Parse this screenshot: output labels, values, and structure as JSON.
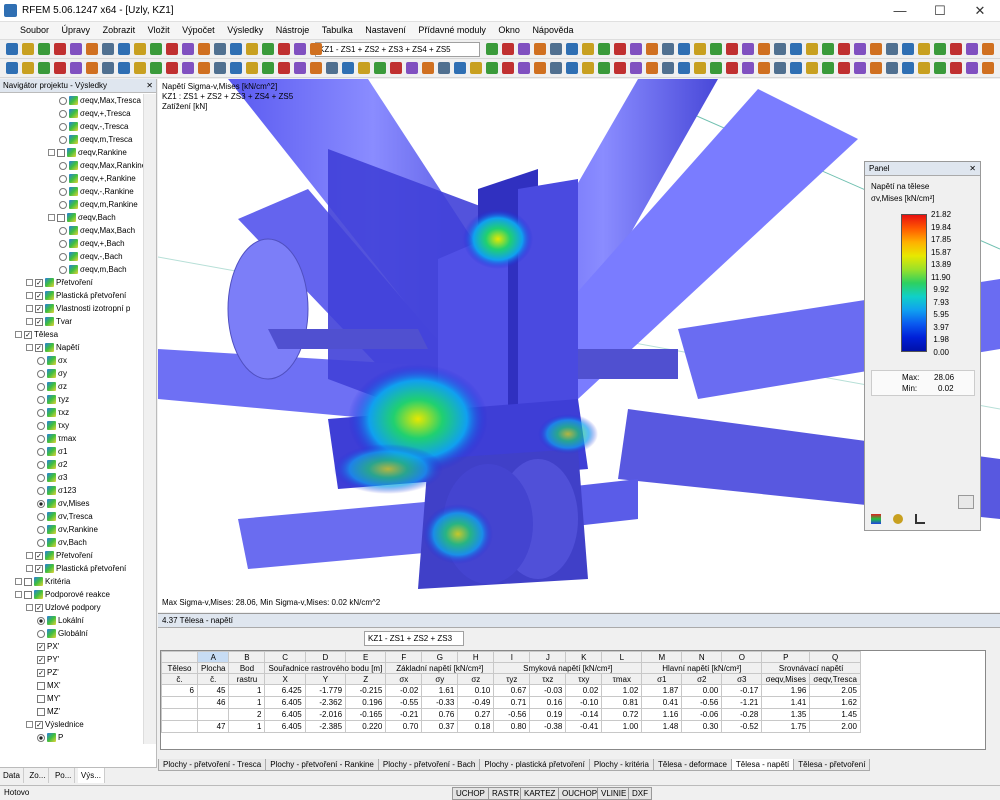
{
  "window": {
    "title": "RFEM 5.06.1247 x64 - [Uzly, KZ1]",
    "min": "—",
    "max": "☐",
    "close": "✕"
  },
  "menu": [
    "Soubor",
    "Úpravy",
    "Zobrazit",
    "Vložit",
    "Výpočet",
    "Výsledky",
    "Nástroje",
    "Tabulka",
    "Nastavení",
    "Přídavné moduly",
    "Okno",
    "Nápověda"
  ],
  "toolbar": {
    "loadcombo": "KZ1 - ZS1 + ZS2 + ZS3 + ZS4 + ZS5"
  },
  "navigator": {
    "title": "Navigátor projektu - Výsledky",
    "close": "✕",
    "rows": [
      {
        "t": "σeqv,Max,Tresca",
        "l": 5,
        "k": "rad"
      },
      {
        "t": "σeqv,+,Tresca",
        "l": 5,
        "k": "rad"
      },
      {
        "t": "σeqv,-,Tresca",
        "l": 5,
        "k": "rad"
      },
      {
        "t": "σeqv,m,Tresca",
        "l": 5,
        "k": "rad"
      },
      {
        "t": "σeqv,Rankine",
        "l": 4,
        "k": "grp"
      },
      {
        "t": "σeqv,Max,Rankine",
        "l": 5,
        "k": "rad"
      },
      {
        "t": "σeqv,+,Rankine",
        "l": 5,
        "k": "rad"
      },
      {
        "t": "σeqv,-,Rankine",
        "l": 5,
        "k": "rad"
      },
      {
        "t": "σeqv,m,Rankine",
        "l": 5,
        "k": "rad"
      },
      {
        "t": "σeqv,Bach",
        "l": 4,
        "k": "grp"
      },
      {
        "t": "σeqv,Max,Bach",
        "l": 5,
        "k": "rad"
      },
      {
        "t": "σeqv,+,Bach",
        "l": 5,
        "k": "rad"
      },
      {
        "t": "σeqv,-,Bach",
        "l": 5,
        "k": "rad"
      },
      {
        "t": "σeqv,m,Bach",
        "l": 5,
        "k": "rad"
      },
      {
        "t": "Přetvoření",
        "l": 2,
        "k": "grpc"
      },
      {
        "t": "Plastická přetvoření",
        "l": 2,
        "k": "grpc"
      },
      {
        "t": "Vlastnosti izotropní p",
        "l": 2,
        "k": "grpc"
      },
      {
        "t": "Tvar",
        "l": 2,
        "k": "grpc"
      },
      {
        "t": "Tělesa",
        "l": 1,
        "k": "chk"
      },
      {
        "t": "Napětí",
        "l": 2,
        "k": "grpc"
      },
      {
        "t": "σx",
        "l": 3,
        "k": "rad"
      },
      {
        "t": "σy",
        "l": 3,
        "k": "rad"
      },
      {
        "t": "σz",
        "l": 3,
        "k": "rad"
      },
      {
        "t": "τyz",
        "l": 3,
        "k": "rad"
      },
      {
        "t": "τxz",
        "l": 3,
        "k": "rad"
      },
      {
        "t": "τxy",
        "l": 3,
        "k": "rad"
      },
      {
        "t": "τmax",
        "l": 3,
        "k": "rad"
      },
      {
        "t": "σ1",
        "l": 3,
        "k": "rad"
      },
      {
        "t": "σ2",
        "l": 3,
        "k": "rad"
      },
      {
        "t": "σ3",
        "l": 3,
        "k": "rad"
      },
      {
        "t": "σ123",
        "l": 3,
        "k": "rad"
      },
      {
        "t": "σv,Mises",
        "l": 3,
        "k": "radon"
      },
      {
        "t": "σv,Tresca",
        "l": 3,
        "k": "rad"
      },
      {
        "t": "σv,Rankine",
        "l": 3,
        "k": "rad"
      },
      {
        "t": "σv,Bach",
        "l": 3,
        "k": "rad"
      },
      {
        "t": "Přetvoření",
        "l": 2,
        "k": "grpc"
      },
      {
        "t": "Plastická přetvoření",
        "l": 2,
        "k": "grpc"
      },
      {
        "t": "Kritéria",
        "l": 1,
        "k": "grp"
      },
      {
        "t": "Podporové reakce",
        "l": 1,
        "k": "grp"
      },
      {
        "t": "Uzlové podpory",
        "l": 2,
        "k": "chk"
      },
      {
        "t": "Lokální",
        "l": 3,
        "k": "radon"
      },
      {
        "t": "Globální",
        "l": 3,
        "k": "rad"
      },
      {
        "t": "PX'",
        "l": 3,
        "k": "chkon"
      },
      {
        "t": "PY'",
        "l": 3,
        "k": "chkon"
      },
      {
        "t": "PZ'",
        "l": 3,
        "k": "chkon"
      },
      {
        "t": "MX'",
        "l": 3,
        "k": "chk0"
      },
      {
        "t": "MY'",
        "l": 3,
        "k": "chk0"
      },
      {
        "t": "MZ'",
        "l": 3,
        "k": "chk0"
      },
      {
        "t": "Výslednice",
        "l": 2,
        "k": "chk"
      },
      {
        "t": "P",
        "l": 3,
        "k": "radon"
      }
    ],
    "tabs": [
      "Data",
      "Zo...",
      "Po...",
      "Výs..."
    ]
  },
  "view": {
    "line1": "Napětí Sigma-v,Mises [kN/cm^2]",
    "line2": "KZ1 : ZS1 + ZS2 + ZS3 + ZS4 + ZS5",
    "line3": "Zatížení [kN]",
    "footer": "Max Sigma-v,Mises: 28.06, Min Sigma-v,Mises: 0.02 kN/cm^2"
  },
  "panel": {
    "title": "Panel",
    "close": "✕",
    "heading": "Napětí na tělese",
    "unit": "σv,Mises [kN/cm²]",
    "levels": [
      "21.82",
      "19.84",
      "17.85",
      "15.87",
      "13.89",
      "11.90",
      "9.92",
      "7.93",
      "5.95",
      "3.97",
      "1.98",
      "0.00"
    ],
    "max_label": "Max:",
    "max": "28.06",
    "min_label": "Min:",
    "min": "0.02"
  },
  "table": {
    "title": "4.37 Tělesa - napětí",
    "combo": "KZ1 - ZS1 + ZS2 + ZS3",
    "letters": [
      "",
      "A",
      "B",
      "C",
      "D",
      "E",
      "F",
      "G",
      "H",
      "I",
      "J",
      "K",
      "L",
      "M",
      "N",
      "O",
      "P",
      "Q"
    ],
    "groups": [
      "Těleso",
      "Plocha",
      "Bod",
      "Souřadnice rastrového bodu [m]",
      "Základní napětí [kN/cm²]",
      "Smyková napětí [kN/cm²]",
      "Hlavní napětí [kN/cm²]",
      "Srovnávací napětí"
    ],
    "sub": [
      "č.",
      "č.",
      "rastru",
      "X",
      "Y",
      "Z",
      "σx",
      "σy",
      "σz",
      "τyz",
      "τxz",
      "τxy",
      "τmax",
      "σ1",
      "σ2",
      "σ3",
      "σeqv,Mises",
      "σeqv,Tresca"
    ],
    "rows": [
      [
        "6",
        "45",
        "1",
        "6.425",
        "-1.779",
        "-0.215",
        "-0.02",
        "1.61",
        "0.10",
        "0.67",
        "-0.03",
        "0.02",
        "1.02",
        "1.87",
        "0.00",
        "-0.17",
        "1.96",
        "2.05"
      ],
      [
        "",
        "46",
        "1",
        "6.405",
        "-2.362",
        "0.196",
        "-0.55",
        "-0.33",
        "-0.49",
        "0.71",
        "0.16",
        "-0.10",
        "0.81",
        "0.41",
        "-0.56",
        "-1.21",
        "1.41",
        "1.62"
      ],
      [
        "",
        "",
        "2",
        "6.405",
        "-2.016",
        "-0.165",
        "-0.21",
        "0.76",
        "0.27",
        "-0.56",
        "0.19",
        "-0.14",
        "0.72",
        "1.16",
        "-0.06",
        "-0.28",
        "1.35",
        "1.45"
      ],
      [
        "",
        "47",
        "1",
        "6.405",
        "-2.385",
        "0.220",
        "0.70",
        "0.37",
        "0.18",
        "0.80",
        "-0.38",
        "-0.41",
        "1.00",
        "1.48",
        "0.30",
        "-0.52",
        "1.75",
        "2.00"
      ]
    ],
    "sheets": [
      "Plochy - přetvoření - Tresca",
      "Plochy - přetvoření - Rankine",
      "Plochy - přetvoření - Bach",
      "Plochy - plastická přetvoření",
      "Plochy - kritéria",
      "Tělesa - deformace",
      "Tělesa - napětí",
      "Tělesa - přetvoření"
    ],
    "active_sheet": "Tělesa - napětí"
  },
  "status": {
    "text": "Hotovo",
    "buttons": [
      "UCHOP",
      "RASTR",
      "KARTEZ",
      "OUCHOP",
      "VLINIE",
      "DXF"
    ]
  }
}
